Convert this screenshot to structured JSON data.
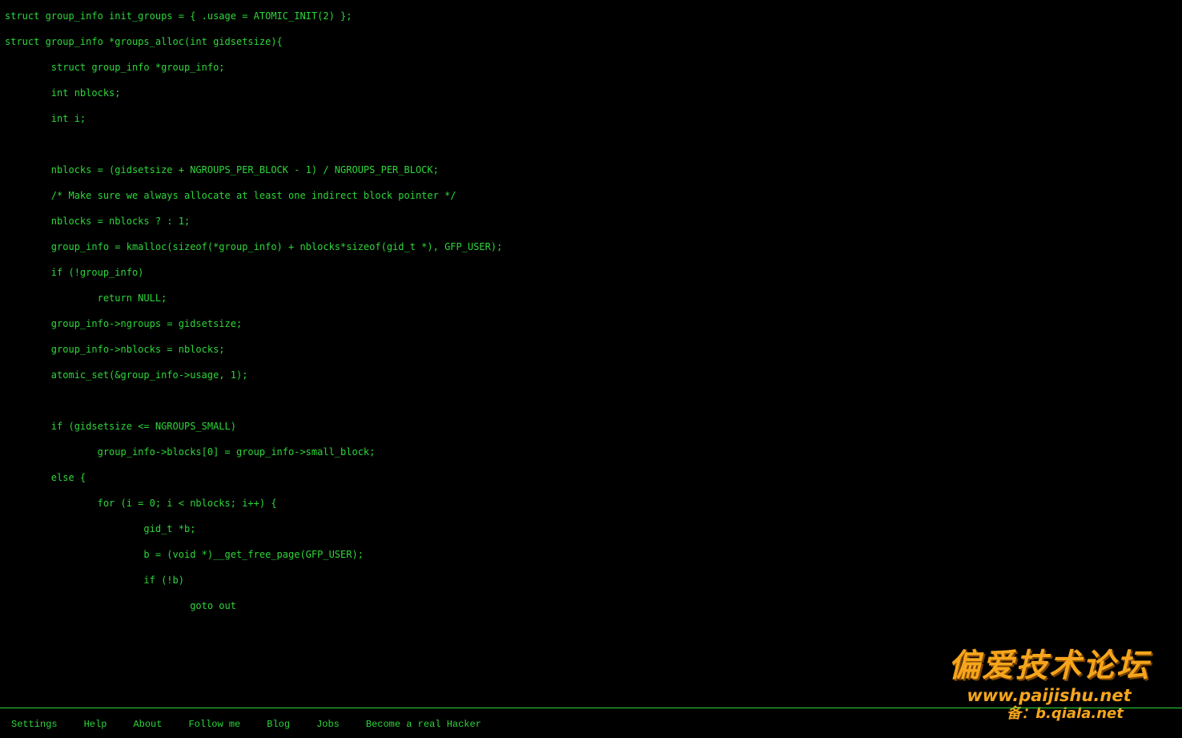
{
  "code_lines": [
    "struct group_info init_groups = { .usage = ATOMIC_INIT(2) };",
    "struct group_info *groups_alloc(int gidsetsize){",
    "        struct group_info *group_info;",
    "        int nblocks;",
    "        int i;",
    "",
    "        nblocks = (gidsetsize + NGROUPS_PER_BLOCK - 1) / NGROUPS_PER_BLOCK;",
    "        /* Make sure we always allocate at least one indirect block pointer */",
    "        nblocks = nblocks ? : 1;",
    "        group_info = kmalloc(sizeof(*group_info) + nblocks*sizeof(gid_t *), GFP_USER);",
    "        if (!group_info)",
    "                return NULL;",
    "        group_info->ngroups = gidsetsize;",
    "        group_info->nblocks = nblocks;",
    "        atomic_set(&group_info->usage, 1);",
    "",
    "        if (gidsetsize <= NGROUPS_SMALL)",
    "                group_info->blocks[0] = group_info->small_block;",
    "        else {",
    "                for (i = 0; i < nblocks; i++) {",
    "                        gid_t *b;",
    "                        b = (void *)__get_free_page(GFP_USER);",
    "                        if (!b)",
    "                                goto out"
  ],
  "watermark": {
    "title": "偏爱技术论坛",
    "url": "www.paijishu.net",
    "alt": "备：b.qiala.net"
  },
  "footer": {
    "settings": "Settings",
    "help": "Help",
    "about": "About",
    "follow": "Follow me",
    "blog": "Blog",
    "jobs": "Jobs",
    "hacker": "Become a real Hacker"
  },
  "colors": {
    "background": "#000000",
    "text": "#2dd63a",
    "watermark": "#f6a51c"
  }
}
